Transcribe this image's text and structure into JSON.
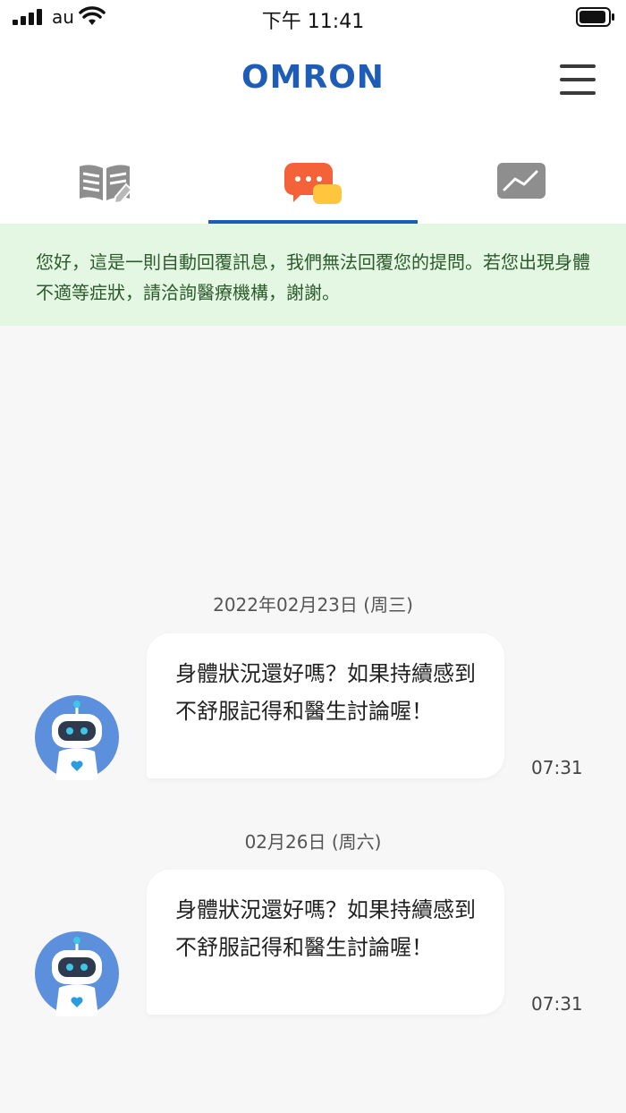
{
  "status_bar": {
    "carrier": "au",
    "time": "下午 11:41"
  },
  "header": {
    "logo": "OMRON",
    "menu_icon": "hamburger-menu-icon"
  },
  "tabs": [
    {
      "icon": "book-edit-icon",
      "active": false
    },
    {
      "icon": "chat-bubbles-icon",
      "active": true
    },
    {
      "icon": "trend-chart-icon",
      "active": false
    }
  ],
  "notice": {
    "text": "您好，這是一則自動回覆訊息，我們無法回覆您的提問。若您出現身體不適等症狀，請洽詢醫療機構，謝謝。"
  },
  "messages": [
    {
      "date": "2022年02月23日 (周三)",
      "text": "身體狀況還好嗎？如果持續感到不舒服記得和醫生討論喔！",
      "time": "07:31",
      "avatar_icon": "robot-avatar-icon"
    },
    {
      "date": "02月26日 (周六)",
      "text": "身體狀況還好嗎？如果持續感到不舒服記得和醫生討論喔！",
      "time": "07:31",
      "avatar_icon": "robot-avatar-icon"
    }
  ],
  "colors": {
    "brand_blue": "#1f5cb8",
    "notice_bg": "#e3f7e3",
    "chat_orange": "#f4623a",
    "chat_yellow": "#ffc53d"
  }
}
